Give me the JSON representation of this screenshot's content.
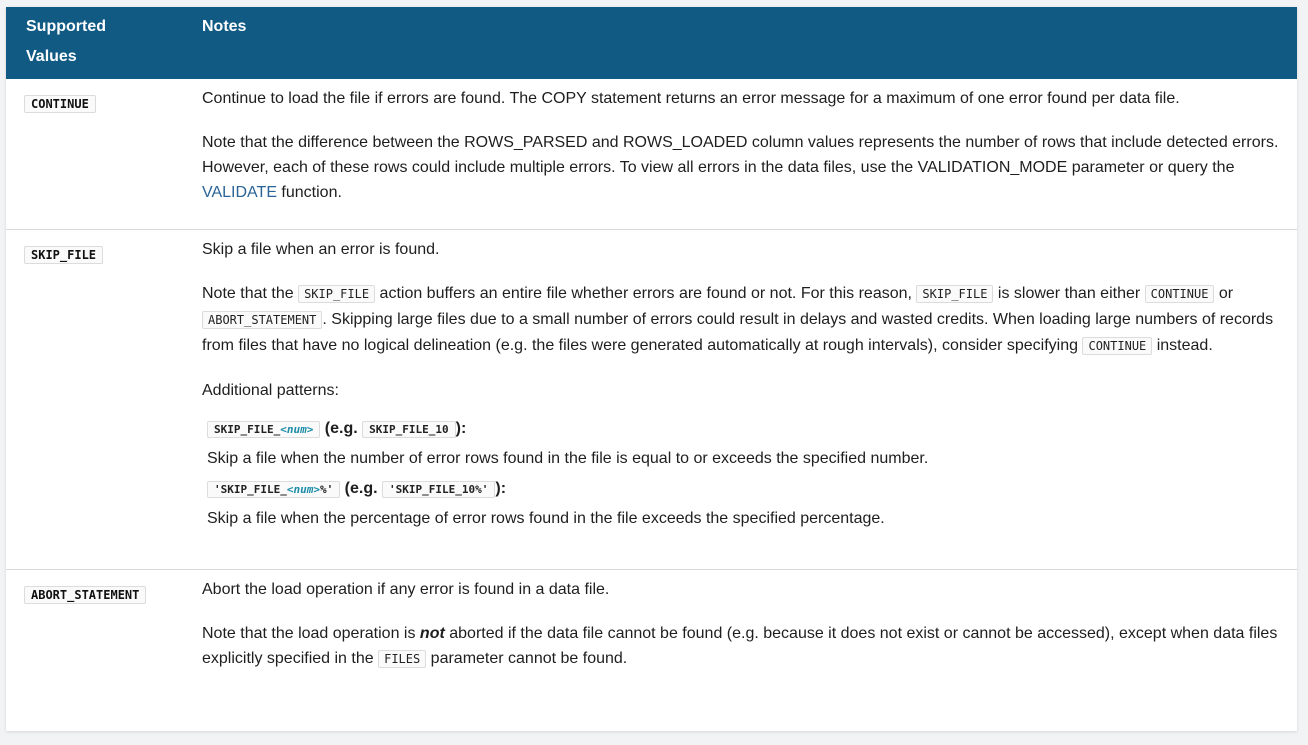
{
  "header": {
    "col1_line1": "Supported",
    "col1_line2": "Values",
    "col2": "Notes"
  },
  "rows": {
    "continue": {
      "value": "CONTINUE",
      "p1": "Continue to load the file if errors are found. The COPY statement returns an error message for a maximum of one error found per data file.",
      "p2_a": "Note that the difference between the ROWS_PARSED and ROWS_LOADED column values represents the number of rows that include detected errors. However, each of these rows could include multiple errors. To view all errors in the data files, use the VALIDATION_MODE parameter or query the ",
      "p2_link": "VALIDATE",
      "p2_b": " function."
    },
    "skip_file": {
      "value": "SKIP_FILE",
      "p1": "Skip a file when an error is found.",
      "p2_a": "Note that the ",
      "p2_code1": "SKIP_FILE",
      "p2_b": " action buffers an entire file whether errors are found or not. For this reason, ",
      "p2_code2": "SKIP_FILE",
      "p2_c": " is slower than either ",
      "p2_code3": "CONTINUE",
      "p2_d": " or ",
      "p2_code4": "ABORT_STATEMENT",
      "p2_e": ". Skipping large files due to a small number of errors could result in delays and wasted credits. When loading large numbers of records from files that have no logical delineation (e.g. the files were generated automatically at rough intervals), consider specifying ",
      "p2_code5": "CONTINUE",
      "p2_f": " instead.",
      "p3": "Additional patterns:",
      "pattern1_prefix": "SKIP_FILE_",
      "pattern1_var": "<num>",
      "pattern1_eg": " (e.g. ",
      "pattern1_example": "SKIP_FILE_10",
      "pattern1_close": "):",
      "pattern1_desc": "Skip a file when the number of error rows found in the file is equal to or exceeds the specified number.",
      "pattern2_prefix": "'SKIP_FILE_",
      "pattern2_var": "<num>",
      "pattern2_suffix": "%'",
      "pattern2_eg": " (e.g. ",
      "pattern2_example": "'SKIP_FILE_10%'",
      "pattern2_close": "):",
      "pattern2_desc": "Skip a file when the percentage of error rows found in the file exceeds the specified percentage."
    },
    "abort": {
      "value": "ABORT_STATEMENT",
      "p1": "Abort the load operation if any error is found in a data file.",
      "p2_a": "Note that the load operation is ",
      "p2_em": "not",
      "p2_b": " aborted if the data file cannot be found (e.g. because it does not exist or cannot be accessed), except when data files explicitly specified in the ",
      "p2_code": "FILES",
      "p2_c": " parameter cannot be found."
    }
  },
  "colors": {
    "header_bg": "#115a84",
    "link": "#2a6496",
    "var": "#1a8ca8"
  }
}
